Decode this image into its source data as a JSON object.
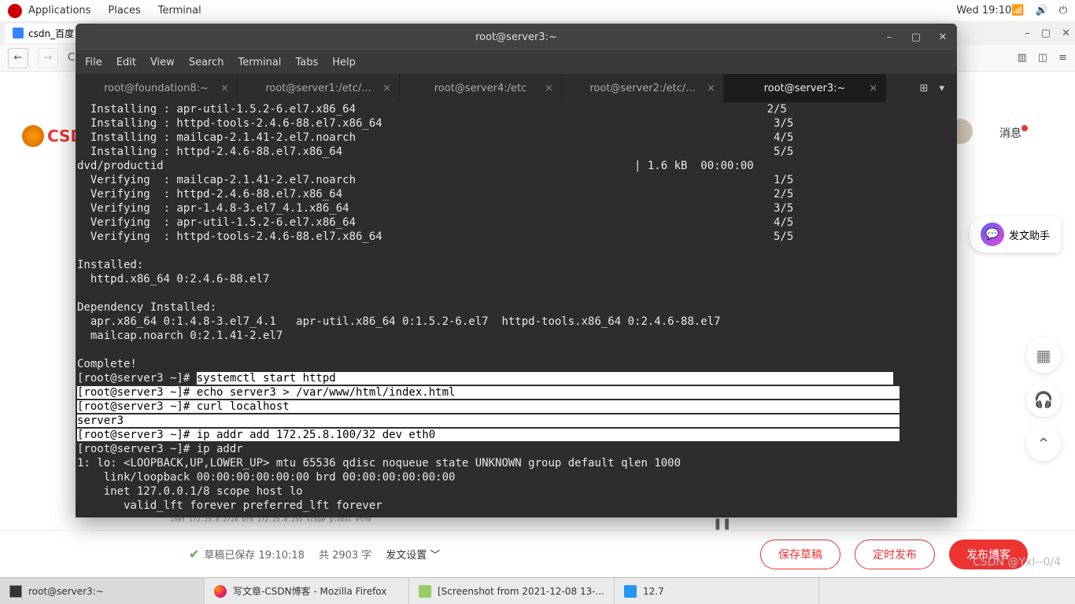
{
  "gnome": {
    "applications": "Applications",
    "places": "Places",
    "terminal_menu": "Terminal",
    "clock": "Wed 19:10"
  },
  "firefox": {
    "tab_title": "csdn_百度",
    "minimize": "–",
    "maximize": "▢",
    "close": "✕"
  },
  "csdn": {
    "logo_text": "CSDN",
    "messages": "消息",
    "publish_helper": "发文助手",
    "draft_saved": "草稿已保存 19:10:18",
    "word_count": "共 2903 字",
    "publish_settings": "发文设置",
    "save_draft": "保存草稿",
    "schedule": "定时发布",
    "publish": "发布博客",
    "watermark": "CSDN @YxI--0/4"
  },
  "bg_code": "inet 172.25.8.2/24 brd 172.25.8.255 scope global eth0",
  "terminal": {
    "window_title": "root@server3:~",
    "menu": {
      "file": "File",
      "edit": "Edit",
      "view": "View",
      "search": "Search",
      "terminal": "Terminal",
      "tabs": "Tabs",
      "help": "Help"
    },
    "tabs": [
      {
        "label": "root@foundation8:~",
        "active": false
      },
      {
        "label": "root@server1:/etc/...",
        "active": false
      },
      {
        "label": "root@server4:/etc",
        "active": false
      },
      {
        "label": "root@server2:/etc/...",
        "active": false
      },
      {
        "label": "root@server3:~",
        "active": true
      }
    ],
    "output_top": "  Installing : apr-util-1.5.2-6.el7.x86_64                                                              2/5\n  Installing : httpd-tools-2.4.6-88.el7.x86_64                                                           3/5\n  Installing : mailcap-2.1.41-2.el7.noarch                                                               4/5\n  Installing : httpd-2.4.6-88.el7.x86_64                                                                 5/5\ndvd/productid                                                                       | 1.6 kB  00:00:00\n  Verifying  : mailcap-2.1.41-2.el7.noarch                                                               1/5\n  Verifying  : httpd-2.4.6-88.el7.x86_64                                                                 2/5\n  Verifying  : apr-1.4.8-3.el7_4.1.x86_64                                                                3/5\n  Verifying  : apr-util-1.5.2-6.el7.x86_64                                                               4/5\n  Verifying  : httpd-tools-2.4.6-88.el7.x86_64                                                           5/5\n\nInstalled:\n  httpd.x86_64 0:2.4.6-88.el7\n\nDependency Installed:\n  apr.x86_64 0:1.4.8-3.el7_4.1   apr-util.x86_64 0:1.5.2-6.el7  httpd-tools.x86_64 0:2.4.6-88.el7\n  mailcap.noarch 0:2.1.41-2.el7\n\nComplete!",
    "hl1_prompt": "[root@server3 ~]# ",
    "hl1_cmd": "systemctl start httpd                                                                                    ",
    "hl_block": "[root@server3 ~]# echo server3 > /var/www/html/index.html                                                                   \n[root@server3 ~]# curl localhost                                                                                            \nserver3                                                                                                                     \n[root@server3 ~]# ip addr add 172.25.8.100/32 dev eth0                                                                      ",
    "output_bottom": "[root@server3 ~]# ip addr\n1: lo: <LOOPBACK,UP,LOWER_UP> mtu 65536 qdisc noqueue state UNKNOWN group default qlen 1000\n    link/loopback 00:00:00:00:00:00 brd 00:00:00:00:00:00\n    inet 127.0.0.1/8 scope host lo\n       valid_lft forever preferred_lft forever"
  },
  "taskbar": {
    "items": [
      {
        "icon": "term",
        "label": "root@server3:~"
      },
      {
        "icon": "ff",
        "label": "写文章-CSDN博客 - Mozilla Firefox"
      },
      {
        "icon": "img",
        "label": "[Screenshot from 2021-12-08 13-..."
      },
      {
        "icon": "doc",
        "label": "12.7"
      }
    ]
  }
}
